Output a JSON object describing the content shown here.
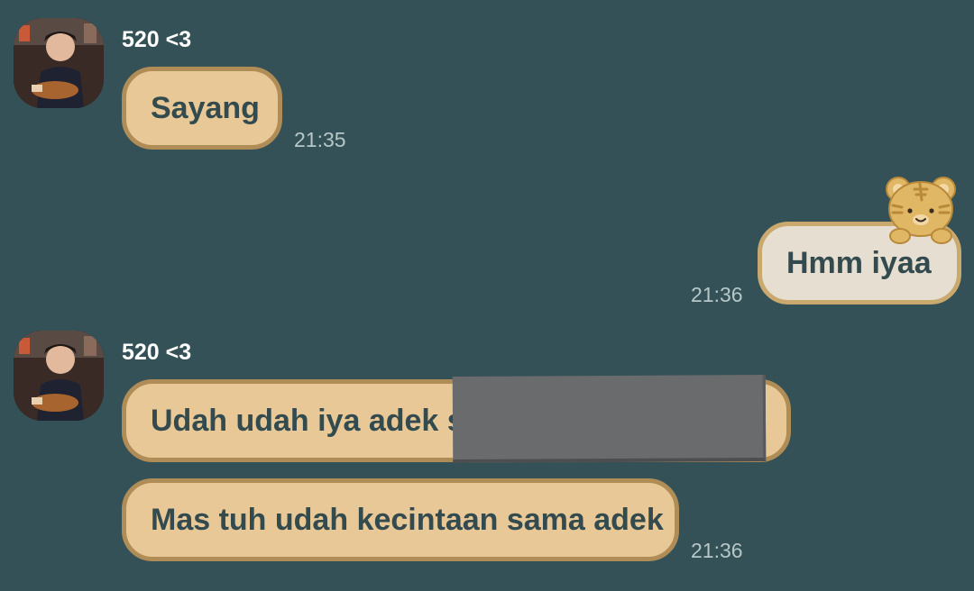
{
  "messages": [
    {
      "sender": "520 <3",
      "text": "Sayang",
      "time": "21:35"
    },
    {
      "text": "Hmm iyaa",
      "time": "21:36",
      "sticker": "tiger-face-icon"
    },
    {
      "sender": "520 <3",
      "text": "Udah udah iya adek s",
      "redacted": true
    },
    {
      "text": "Mas tuh udah kecintaan sama adek",
      "time": "21:36"
    }
  ],
  "colors": {
    "background": "#335156",
    "incoming_bubble": "#e8c896",
    "outgoing_bubble": "#e6ded0",
    "bubble_border": "#b08d57",
    "bubble_text": "#334a4e",
    "timestamp": "#b7c7c7"
  }
}
